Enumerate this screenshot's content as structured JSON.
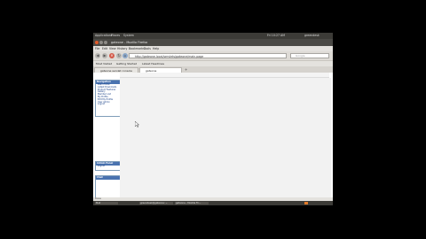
{
  "topbar": {
    "apps": [
      "Applications",
      "Places",
      "System"
    ],
    "clock": "Fri 10:27 AM",
    "user": "greendesk"
  },
  "window": {
    "title": "gateone - Mozilla Firefox"
  },
  "menu": [
    "File",
    "Edit",
    "View",
    "History",
    "Bookmarks",
    "Tools",
    "Help"
  ],
  "nav": {
    "back": "◀",
    "forward": "▶",
    "url": "http://gateone.local/servlets/gateone/main.page",
    "search_placeholder": "Google"
  },
  "bookmarks": [
    "Most Visited",
    "Getting Started",
    "Latest Headlines"
  ],
  "tabs": [
    "gateone servlet console",
    "gateone"
  ],
  "sidebar": {
    "nav_header": "Navigation",
    "nav_items": [
      "Main Home",
      "Latest Downloads",
      "Product Features",
      "Gallery",
      "Member List",
      "My Profile",
      "Edit My Profile",
      "User Admin",
      "Logout"
    ],
    "admin_header": "Admin Panel",
    "admin_items": [
      "Logout"
    ],
    "blank_header": "Chat",
    "poll_header": "Online Users",
    "poll_text": "No Members Online"
  },
  "status": {
    "text": "Done"
  },
  "taskbar": {
    "items": [
      "Mail",
      "greendesk@gateone: ~",
      "gateone - Mozilla Fir..."
    ]
  }
}
